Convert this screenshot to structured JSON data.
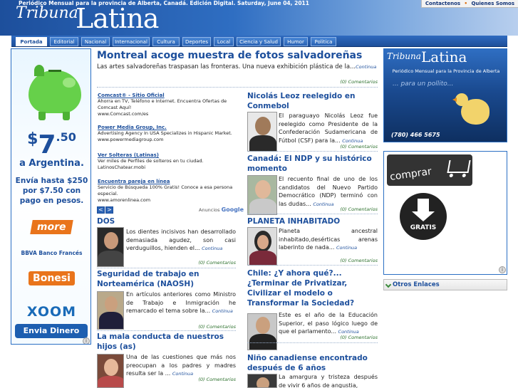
{
  "header": {
    "topline": "Periódico Mensual para la provincia de Alberta, Canadá. Edición Digital. Saturday, June 04, 2011",
    "logo_tribuna": "Tribuna",
    "logo_latina": "Latina",
    "links": [
      "Contactenos",
      "Quienes Somos"
    ],
    "separator": "•"
  },
  "nav": {
    "tabs": [
      "Portada",
      "Editorial",
      "Nacional",
      "Internacional",
      "Cultura",
      "Deportes",
      "Local",
      "Ciencia y Salud",
      "Humor",
      "Politica"
    ],
    "active_index": 0
  },
  "left_ad": {
    "price_dollar": "$",
    "price_main": "7",
    "price_cents": ".50",
    "to": "a Argentina.",
    "desc": "Envía hasta $250 por $7.50 con pago en pesos.",
    "brand1": "more",
    "brand2": "BBVA Banco Francés",
    "brand3": "Bonesi",
    "brand4": "XOOM",
    "cta": "Envia Dinero",
    "info_icon": "i"
  },
  "main": {
    "headline": "Montreal acoge muestra de fotos salvadoreñas",
    "lead": "Las artes salvadoreñas traspasan las fronteras. Una nueva exhibición plástica de la...",
    "continua": "Continua",
    "lead_comments": "(0) Comentarios"
  },
  "google_ads": {
    "items": [
      {
        "title": "Comcast® - Sitio Oficial",
        "desc": "Ahorra en TV, Teléfono e Internet. Encuentra Ofertas de Comcast Aquí!",
        "url": "www.Comcast.com/es"
      },
      {
        "title": "Power Media Group, Inc.",
        "desc": "Advertising Agency In USA Specializes in Hispanic Market.",
        "url": "www.powermediagroup.com"
      },
      {
        "title": "Ver Solteras (Latinas)",
        "desc": "Ver miles de Perfiles de solteros en tu ciudad.",
        "url": "LatinosChatear.mobi"
      },
      {
        "title": "Encuentra pareja en línea",
        "desc": "Servicio de Búsqueda 100% Gratis! Conoce a esa persona especial.",
        "url": "www.amorenlinea.com"
      }
    ],
    "prev": "<",
    "next": ">",
    "anuncios": "Anuncios",
    "google": "Google"
  },
  "articles_left": [
    {
      "title": "DOS",
      "body": "Los dientes incisivos han desarrollado demasiada agudez, son casi verduguillos, hienden el...",
      "continua": "Continua",
      "comments": "(0) Comentarios"
    },
    {
      "title": "Seguridad de trabajo en Norteamérica (NAOSH)",
      "body": "En artículos anteriores como Ministro de Trabajo e Inmigración he remarcado el tema sobre la...",
      "continua": "Continua",
      "comments": "(0) Comentarios"
    },
    {
      "title": "La mala conducta de nuestros hijos (as)",
      "body": "Una de las cuestiones que más nos preocupan a los padres y madres resulta ser la ...",
      "continua": "Continua",
      "comments": "(0) Comentarios"
    }
  ],
  "articles_right": [
    {
      "title": "Nicolás Leoz reelegido en Conmebol",
      "body": "El paraguayo Nicolás Leoz fue reelegido como Presidente de la Confederación Sudamericana de Fútbol (CSF) para la...",
      "continua": "Continua",
      "comments": "(0) Comentarios"
    },
    {
      "title": "Canadá: El NDP y su histórico momento",
      "body": "El recuento final de uno de los candidatos del Nuevo Partido Democrático (NDP) terminó con las dudas...",
      "continua": "Continua",
      "comments": "(0) Comentarios"
    },
    {
      "title": "PLANETA INHABITADO",
      "body": "Planeta ancestral inhabitado,desérticas arenas laberinto de nada...",
      "continua": "Continua",
      "comments": "(0) Comentarios"
    },
    {
      "title": "Chile: ¿Y ahora qué?... ¿Terminar de Privatizar, Civilizar el modelo o Transformar la Sociedad?",
      "body": "Este es el año de la Educación Superior, el paso lógico luego de que el parlamento...",
      "continua": "Continua",
      "comments": "(0) Comentarios"
    },
    {
      "title": "Niño canadiense encontrado después de 6 años",
      "body": "La amargura y tristeza después de vivir 6 años de angustia,",
      "continua": "",
      "comments": ""
    }
  ],
  "right": {
    "box1_tribuna": "Tribuna",
    "box1_latina": "Latina",
    "box1_sub": "Periódico Mensual para la Provincia de Alberta",
    "box1_quote": "... para un pollito...",
    "box1_phone": "(780) 466 5675",
    "comprar": "comprar",
    "gratis": "GRATIS",
    "info_icon": "i",
    "otros_enlaces": "Otros Enlaces"
  },
  "colors": {
    "brand_blue": "#1d4f9c",
    "comment_green": "#2a6f2a",
    "accent_orange": "#e9741b"
  }
}
